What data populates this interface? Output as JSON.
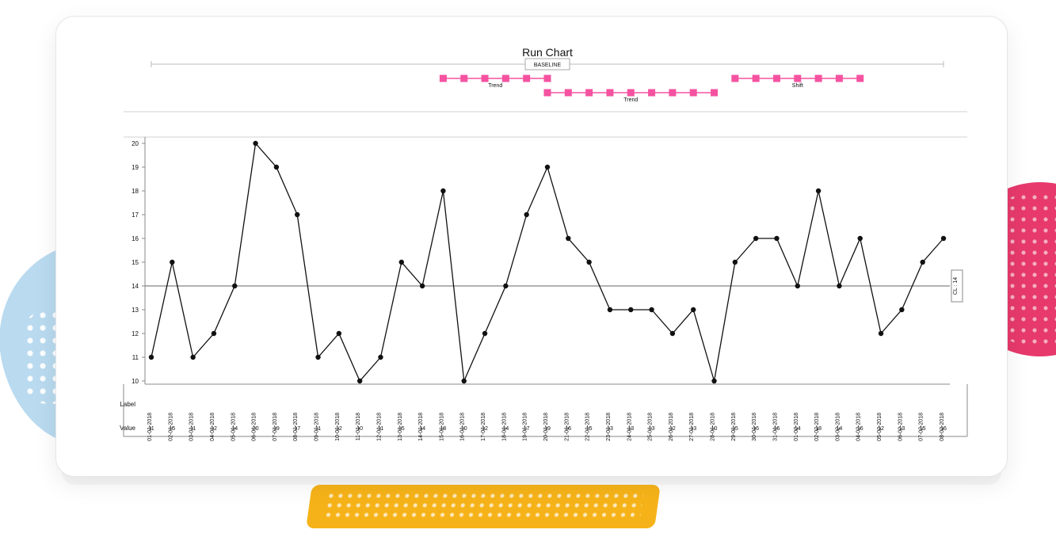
{
  "chart_data": {
    "type": "line",
    "title": "Run Chart",
    "baseline_label": "BASELINE",
    "cl_label": "CL : 14",
    "cl_value": 14,
    "ylim": [
      10,
      20
    ],
    "yticks": [
      10,
      11,
      12,
      13,
      14,
      15,
      16,
      17,
      18,
      19,
      20
    ],
    "row_labels": {
      "label": "Label",
      "value": "Value"
    },
    "categories": [
      "01-01-2018",
      "02-01-2018",
      "03-01-2018",
      "04-01-2018",
      "05-01-2018",
      "06-01-2018",
      "07-01-2018",
      "08-01-2018",
      "09-01-2018",
      "10-01-2018",
      "11-01-2018",
      "12-01-2018",
      "13-01-2018",
      "14-01-2018",
      "15-01-2018",
      "16-01-2018",
      "17-01-2018",
      "18-01-2018",
      "19-01-2018",
      "20-01-2018",
      "21-01-2018",
      "22-01-2018",
      "23-01-2018",
      "24-01-2018",
      "25-01-2018",
      "26-01-2018",
      "27-01-2018",
      "28-01-2018",
      "29-01-2018",
      "30-01-2018",
      "31-01-2018",
      "01-02-2018",
      "02-02-2018",
      "03-02-2018",
      "04-02-2018",
      "05-02-2018",
      "06-02-2018",
      "07-02-2018",
      "08-02-2018"
    ],
    "values": [
      11,
      15,
      11,
      12,
      14,
      20,
      19,
      17,
      11,
      12,
      10,
      11,
      15,
      14,
      18,
      10,
      12,
      14,
      17,
      19,
      16,
      15,
      13,
      13,
      13,
      12,
      13,
      10,
      15,
      16,
      16,
      14,
      18,
      14,
      16,
      12,
      13,
      15,
      16
    ],
    "annotations": [
      {
        "label": "Trend",
        "from": 14,
        "to": 19,
        "row": 0
      },
      {
        "label": "Shift",
        "from": 28,
        "to": 34,
        "row": 0
      },
      {
        "label": "Trend",
        "from": 19,
        "to": 27,
        "row": 1
      }
    ]
  }
}
